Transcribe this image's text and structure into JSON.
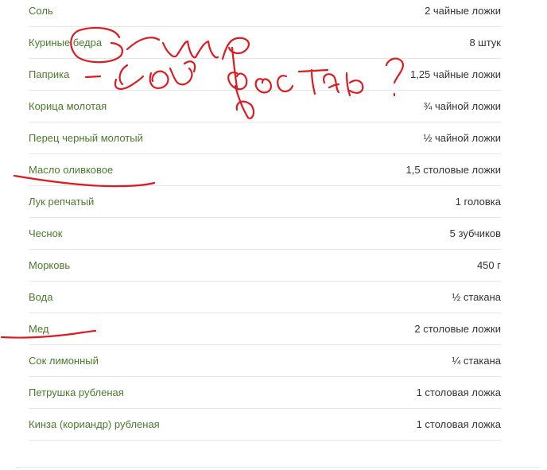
{
  "ingredients": [
    {
      "name": "Соль",
      "qty": "2 чайные ложки"
    },
    {
      "name": "Куриные бедра",
      "qty": "8 штук"
    },
    {
      "name": "Паприка",
      "qty": "1,25 чайные ложки"
    },
    {
      "name": "Корица молотая",
      "qty": "¾ чайной ложки"
    },
    {
      "name": "Перец черный молотый",
      "qty": "½ чайной ложки"
    },
    {
      "name": "Масло оливковое",
      "qty": "1,5 столовые ложки"
    },
    {
      "name": "Лук репчатый",
      "qty": "1 головка"
    },
    {
      "name": "Чеснок",
      "qty": "5 зубчиков"
    },
    {
      "name": "Морковь",
      "qty": "450 г"
    },
    {
      "name": "Вода",
      "qty": "½ стакана"
    },
    {
      "name": "Мед",
      "qty": "2 столовые ложки"
    },
    {
      "name": "Сок лимонный",
      "qty": "¼ стакана"
    },
    {
      "name": "Петрушка рубленая",
      "qty": "1 столовая ложка"
    },
    {
      "name": "Кинза (кориандр) рубленая",
      "qty": "1 столовая ложка"
    }
  ],
  "colors": {
    "ingredient_name": "#4a7a2b",
    "quantity": "#333333",
    "divider": "#e6e6e6",
    "annotation_ink": "#e0191f"
  }
}
